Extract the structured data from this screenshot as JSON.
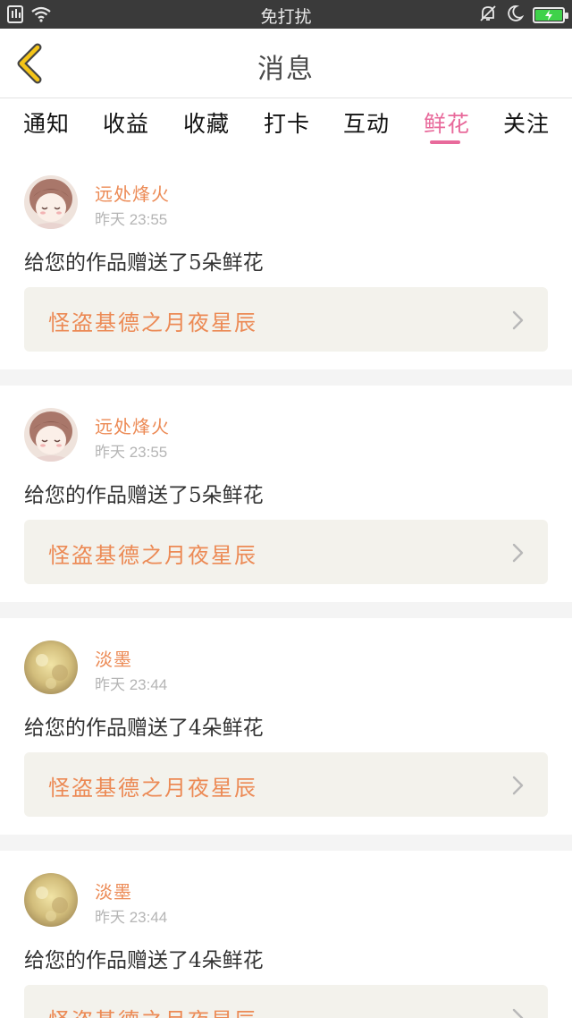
{
  "status_bar": {
    "dnd_label": "免打扰"
  },
  "header": {
    "title": "消息"
  },
  "tabs": [
    {
      "label": "通知"
    },
    {
      "label": "收益"
    },
    {
      "label": "收藏"
    },
    {
      "label": "打卡"
    },
    {
      "label": "互动"
    },
    {
      "label": "鲜花",
      "active": true
    },
    {
      "label": "关注"
    }
  ],
  "feed": [
    {
      "user": "远处烽火",
      "time": "昨天 23:55",
      "message": "给您的作品赠送了5朵鲜花",
      "work": "怪盗基德之月夜星辰",
      "avatar": "girl-avatar"
    },
    {
      "user": "远处烽火",
      "time": "昨天 23:55",
      "message": "给您的作品赠送了5朵鲜花",
      "work": "怪盗基德之月夜星辰",
      "avatar": "girl-avatar"
    },
    {
      "user": "淡墨",
      "time": "昨天 23:44",
      "message": "给您的作品赠送了4朵鲜花",
      "work": "怪盗基德之月夜星辰",
      "avatar": "golden-avatar"
    },
    {
      "user": "淡墨",
      "time": "昨天 23:44",
      "message": "给您的作品赠送了4朵鲜花",
      "work": "怪盗基德之月夜星辰",
      "avatar": "golden-avatar"
    }
  ],
  "colors": {
    "accent": "#e86a9b",
    "username": "#ec8a55",
    "link_bg": "#f3f2ec",
    "status_bar": "#3a3a3a"
  }
}
